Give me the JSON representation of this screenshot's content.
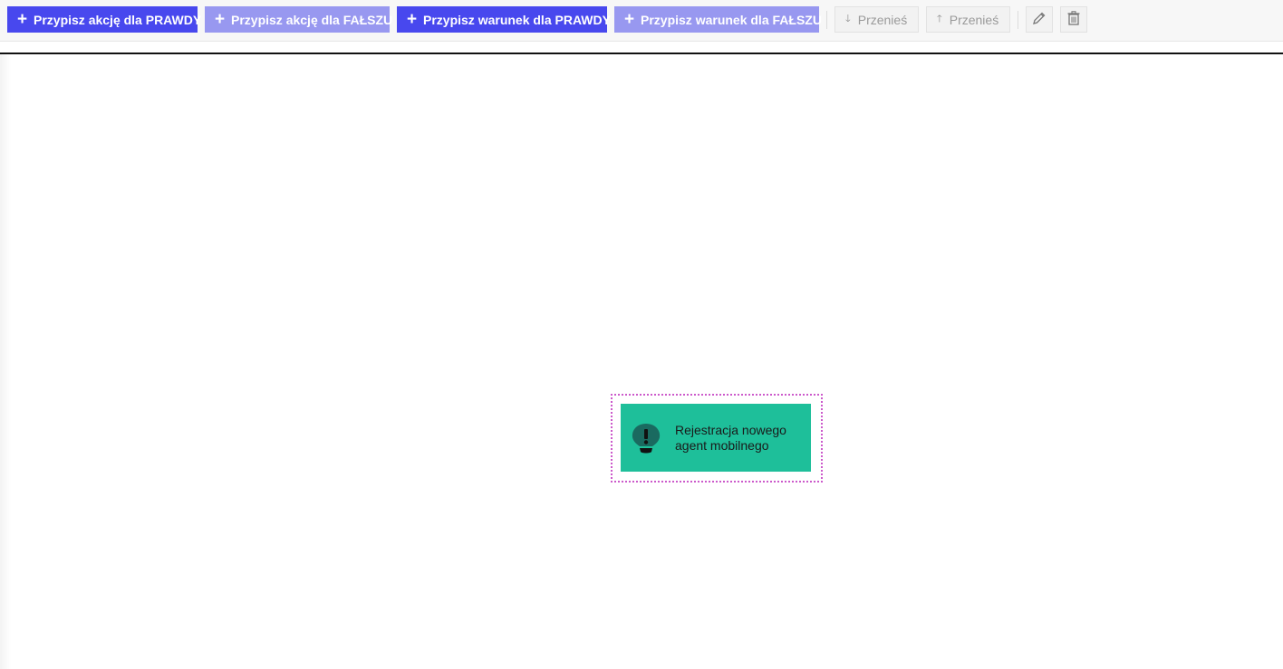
{
  "toolbar": {
    "assign_action_true": "Przypisz akcję dla PRAWDY",
    "assign_action_false": "Przypisz akcję dla FAŁSZU",
    "assign_condition_true": "Przypisz warunek dla PRAWDY",
    "assign_condition_false": "Przypisz warunek dla FAŁSZU",
    "move_down": "Przenieś",
    "move_up": "Przenieś",
    "plus_glyph": "+",
    "down_glyph": "🡓",
    "up_glyph": "🡑",
    "icons": {
      "move_down": "arrow-down-icon",
      "move_up": "arrow-up-icon",
      "edit": "pencil-icon",
      "delete": "trash-icon"
    }
  },
  "canvas": {
    "node": {
      "label_line1": "Rejestracja nowego",
      "label_line2": "agent mobilnego",
      "icon": "alert-bulb-icon",
      "color": "#1ebf9a"
    }
  },
  "colors": {
    "primary": "#4848ee",
    "primary_light": "#9898f0",
    "selection_outline": "#cc5acb"
  }
}
